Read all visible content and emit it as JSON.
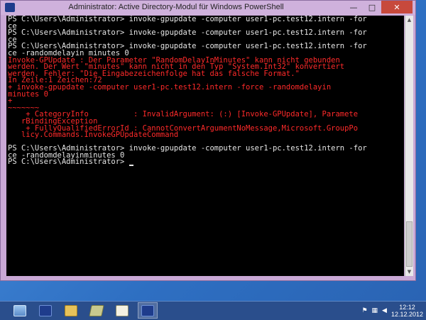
{
  "window": {
    "title": "Administrator: Active Directory-Modul für Windows PowerShell",
    "controls": {
      "minimize": "—",
      "maximize": "□",
      "close": "✕"
    }
  },
  "console": {
    "lines": [
      {
        "text": "PS C:\\Users\\Administrator> invoke-gpupdate -computer user1-pc.test12.intern -for",
        "color": "white"
      },
      {
        "text": "ce",
        "color": "white"
      },
      {
        "text": "PS C:\\Users\\Administrator> invoke-gpupdate -computer user1-pc.test12.intern -for",
        "color": "white"
      },
      {
        "text": "ce",
        "color": "white"
      },
      {
        "text": "PS C:\\Users\\Administrator> invoke-gpupdate -computer user1-pc.test12.intern -for",
        "color": "white"
      },
      {
        "text": "ce -randomdelayin minutes 0",
        "color": "white"
      },
      {
        "text": "Invoke-GPUpdate : Der Parameter \"RandomDelayInMinutes\" kann nicht gebunden",
        "color": "red"
      },
      {
        "text": "werden. Der Wert \"minutes\" kann nicht in den Typ \"System.Int32\" konvertiert",
        "color": "red"
      },
      {
        "text": "werden. Fehler: \"Die Eingabezeichenfolge hat das falsche Format.\"",
        "color": "red"
      },
      {
        "text": "In Zeile:1 Zeichen:72",
        "color": "red"
      },
      {
        "text": "+ invoke-gpupdate -computer user1-pc.test12.intern -force -randomdelayin",
        "color": "red"
      },
      {
        "text": "minutes 0",
        "color": "red"
      },
      {
        "text": "+",
        "color": "red"
      },
      {
        "text": "~~~~~~~",
        "color": "red"
      },
      {
        "text": "    + CategoryInfo          : InvalidArgument: (:) [Invoke-GPUpdate], Paramete",
        "color": "red"
      },
      {
        "text": "   rBindingException",
        "color": "red"
      },
      {
        "text": "    + FullyQualifiedErrorId : CannotConvertArgumentNoMessage,Microsoft.GroupPo",
        "color": "red"
      },
      {
        "text": "   licy.Commands.InvokeGPUpdateCommand",
        "color": "red"
      },
      {
        "text": "",
        "color": "white"
      },
      {
        "text": "PS C:\\Users\\Administrator> invoke-gpupdate -computer user1-pc.test12.intern -for",
        "color": "white"
      },
      {
        "text": "ce -randomdelayinminutes 0",
        "color": "white"
      },
      {
        "text": "PS C:\\Users\\Administrator> ",
        "color": "white",
        "cursor": true
      }
    ]
  },
  "taskbar": {
    "apps": [
      {
        "name": "server-manager-icon",
        "active": false
      },
      {
        "name": "powershell-icon",
        "active": false
      },
      {
        "name": "file-explorer-icon",
        "active": false
      },
      {
        "name": "ad-tools-icon",
        "active": false
      },
      {
        "name": "notepad-icon",
        "active": false
      },
      {
        "name": "ad-powershell-icon",
        "active": true
      }
    ],
    "clock": {
      "time": "12:12",
      "date": "12.12.2012"
    },
    "tray_icons": [
      "flag-icon",
      "network-icon",
      "volume-icon"
    ]
  },
  "colors": {
    "console_white": "#e6e6e6",
    "console_red": "#ff2a2a",
    "taskbar": "#2a4e8c",
    "window_frame": "#c9a8d6"
  }
}
